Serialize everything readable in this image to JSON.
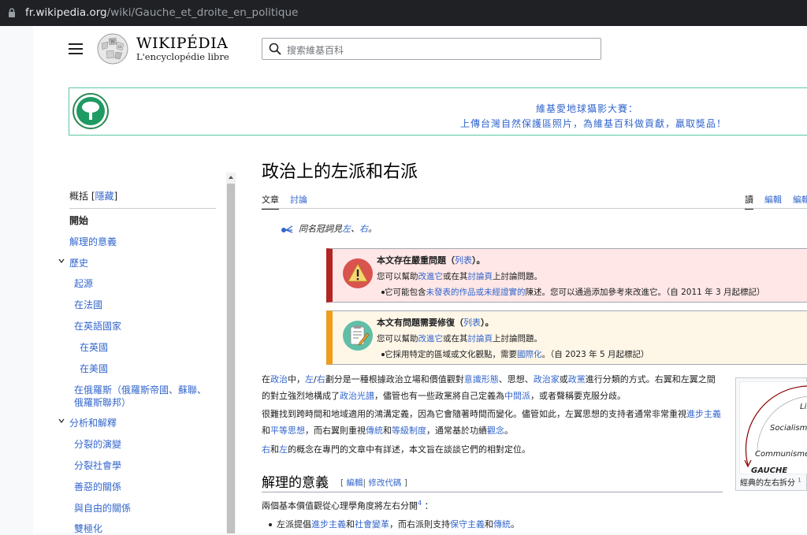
{
  "browser": {
    "url_host": "fr.wikipedia.org",
    "url_path": "/wiki/Gauche_et_droite_en_politique"
  },
  "header": {
    "wordmark": "WIKIPÉDIA",
    "tagline": "L'encyclopédie libre",
    "search_placeholder": "搜索維基百科"
  },
  "banner": {
    "line1": "維基愛地球攝影大賽：",
    "line2": "上傳台灣自然保護區照片，為維基百科做貢獻，贏取獎品！"
  },
  "toc": {
    "head_text": "概括 [",
    "head_link": "隱藏",
    "head_end": "]",
    "items": [
      {
        "label": "開始"
      },
      {
        "label": "解理的意義"
      },
      {
        "label": "歷史"
      },
      {
        "label": "起源"
      },
      {
        "label": "在法國"
      },
      {
        "label": "在英語國家"
      },
      {
        "label": "在英國"
      },
      {
        "label": "在美國"
      },
      {
        "label": "在俄羅斯（俄羅斯帝國、蘇聯、"
      },
      {
        "label": "俄羅斯聯邦）"
      },
      {
        "label": "分析和解釋"
      },
      {
        "label": "分裂的演變"
      },
      {
        "label": "分裂社會學"
      },
      {
        "label": "善惡的關係"
      },
      {
        "label": "與自由的關係"
      },
      {
        "label": "雙極化"
      }
    ]
  },
  "article": {
    "title": "政治上的左派和右派",
    "tabs": {
      "article": "文章",
      "talk": "討論",
      "read": "讀",
      "edit": "編輯",
      "edit_source": "編輯"
    },
    "hatnote": {
      "prefix": "同名冠詞見",
      "link1": "左",
      "sep": "、",
      "link2": "右",
      "suffix": "。"
    },
    "ambox1": {
      "title": "本文存在嚴重問題（",
      "title_link": "列表",
      "title_end": "）。",
      "line2_a": "您可以幫助",
      "line2_link1": "改進它",
      "line2_b": "或在其",
      "line2_link2": "討論頁",
      "line2_c": "上討論問題。",
      "bullet_a": "它可能包含",
      "bullet_link": "未發表的作品或未經證實的",
      "bullet_b": "陳述。您可以通過添加參考來改進它。（自 2011 年 3 月起標記）"
    },
    "ambox2": {
      "title": "本文有問題需要修復（",
      "title_link": "列表",
      "title_end": "）。",
      "line2_a": "您可以幫助",
      "line2_link1": "改進它",
      "line2_b": "或在其",
      "line2_link2": "討論頁",
      "line2_c": "上討論問題。",
      "bullet_a": "它採用特定的區域或文化觀點，需要",
      "bullet_link": "國際化",
      "bullet_b": "。（自 2023 年 5 月起標記）"
    },
    "p1": {
      "t1": "在",
      "l1": "政治",
      "t2": "中，",
      "l2": "左",
      "t3": "/",
      "l3": "右",
      "t4": "劃分是一種根據政治立場和價值觀對",
      "l4": "意識形態",
      "t5": "、思想、",
      "l5": "政治家",
      "t6": "或",
      "l6": "政黨",
      "t7": "進行分類的方式。右翼和左翼之間的對立強烈地構成了",
      "l7": "政治光譜",
      "t8": "，儘管也有一些政黨將自己定義為",
      "l8": "中間派",
      "t9": "，或者聲稱要克服分歧。"
    },
    "p2": {
      "t1": "很難找到跨時間和地域適用的鴻溝定義，因為它會隨著時間而變化。儘管如此，左翼思想的支持者通常非常重視",
      "l1": "進步主義",
      "t2": "和",
      "l2": "平等思想",
      "t3": "，而右翼則重視",
      "l3": "傳統",
      "t4": "和",
      "l4": "等級制度",
      "t5": "，通常基於功績",
      "l5": "觀念",
      "t6": "。"
    },
    "p3": {
      "l1": "右",
      "t1": "和",
      "l2": "左",
      "t2": "的概念在專門的文章中有詳述，本文旨在談談它們的相對定位。"
    },
    "section": {
      "title": "解理的意義",
      "edit_open": "[",
      "edit": "編輯",
      "sep": "|",
      "edit_code": "修改代碼",
      "edit_close": "]"
    },
    "p4": {
      "text": "兩個基本價值觀從心理學角度將左右分開",
      "ref": "4",
      "end": "："
    },
    "bullet1": {
      "t1": "左派提倡",
      "l1": "進步主義",
      "t2": "和",
      "l2": "社會變革",
      "t3": "，而右派則支持",
      "l3": "保守主義",
      "t4": "和",
      "l4": "傳統",
      "t5": "。"
    },
    "infobox": {
      "labels": [
        "Lib",
        "Socialisme",
        "Communisme",
        "GAUCHE"
      ],
      "caption": "經典的左右拆分",
      "ref": "1"
    }
  },
  "colors": {
    "link": "#3366cc",
    "ambox_red": "#b32424",
    "ambox_orange": "#ef9c1a",
    "banner_border": "#5bc6a4"
  }
}
